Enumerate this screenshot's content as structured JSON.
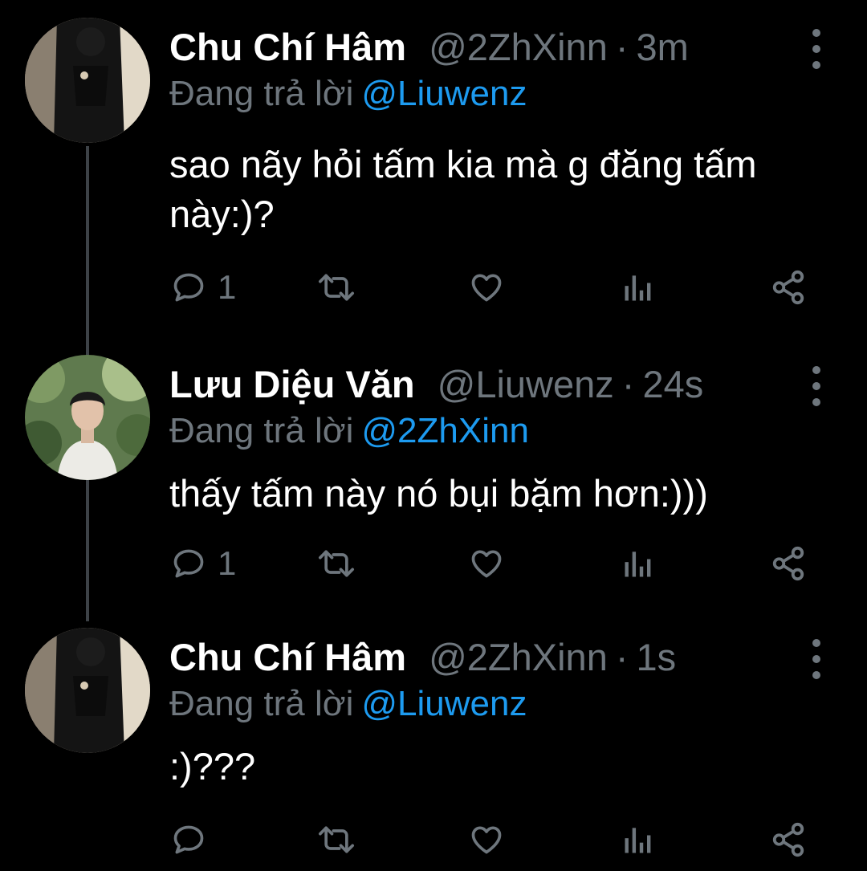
{
  "thread": [
    {
      "name": "Chu Chí Hâm",
      "handle": "@2ZhXinn",
      "separator": "·",
      "time": "3m",
      "reply_prefix": "Đang trả lời",
      "reply_to": "@Liuwenz",
      "text": "sao nãy hỏi tấm kia mà g đăng tấm này:)?",
      "reply_count": "1",
      "avatar_icon": "dark-figure-avatar"
    },
    {
      "name": "Lưu Diệu Văn",
      "handle": "@Liuwenz",
      "separator": "·",
      "time": "24s",
      "reply_prefix": "Đang trả lời",
      "reply_to": "@2ZhXinn",
      "text": "thấy tấm này nó bụi bặm hơn:)))",
      "reply_count": "1",
      "avatar_icon": "outdoor-portrait-avatar"
    },
    {
      "name": "Chu Chí Hâm",
      "handle": "@2ZhXinn",
      "separator": "·",
      "time": "1s",
      "reply_prefix": "Đang trả lời",
      "reply_to": "@Liuwenz",
      "text": ":)???",
      "reply_count": "",
      "avatar_icon": "dark-figure-avatar"
    }
  ],
  "colors": {
    "background": "#000000",
    "text": "#ffffff",
    "muted": "#6e767d",
    "link": "#1d9bf0",
    "thread_line": "#3d4247"
  }
}
